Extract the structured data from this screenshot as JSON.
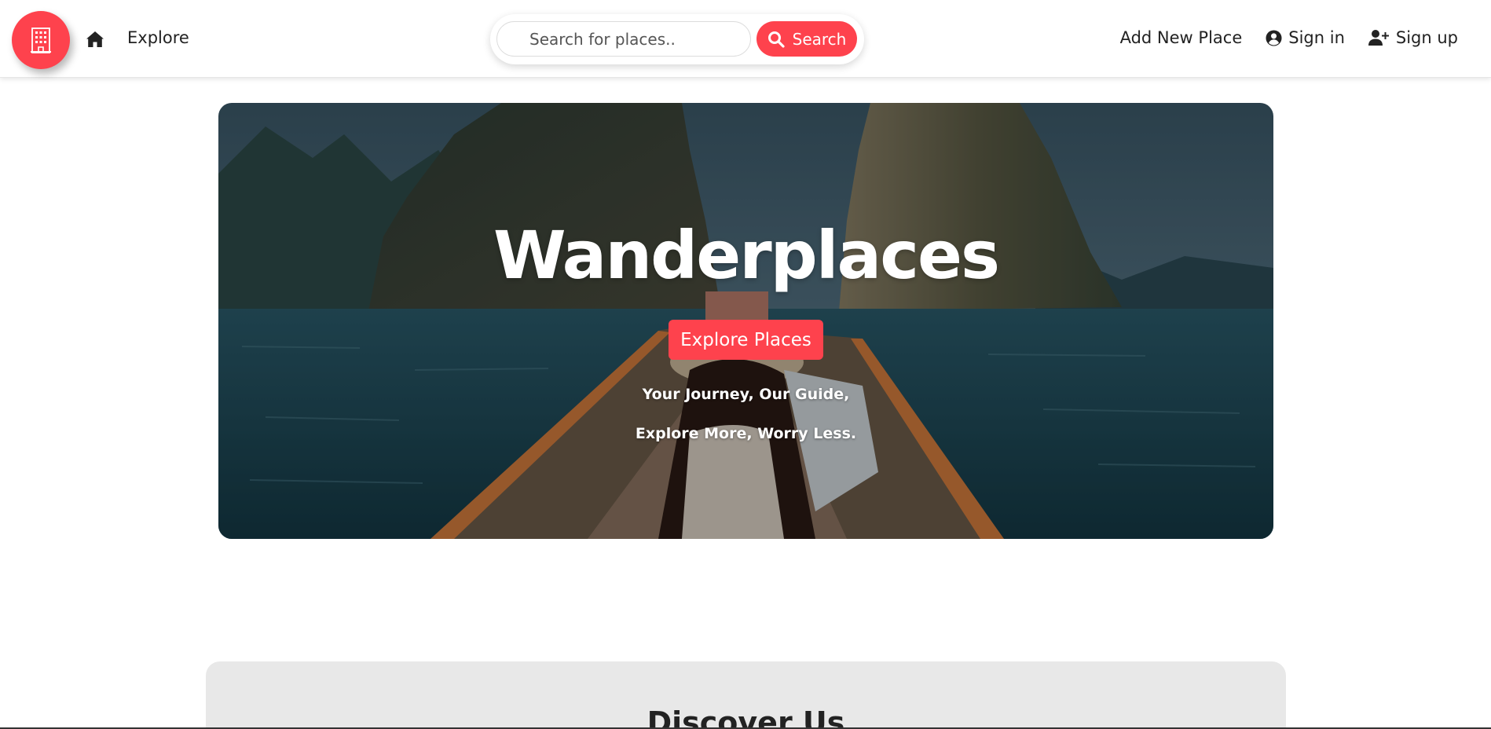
{
  "navbar": {
    "logo_icon": "building-icon",
    "home_icon": "home-icon",
    "explore_label": "Explore",
    "search": {
      "placeholder": "Search for places..",
      "value": "",
      "button_label": "Search",
      "button_icon": "search-icon"
    },
    "add_place_label": "Add New Place",
    "signin_label": "Sign in",
    "signin_icon": "user-circle-icon",
    "signup_label": "Sign up",
    "signup_icon": "user-plus-icon"
  },
  "hero": {
    "title": "Wanderplaces",
    "button_label": "Explore Places",
    "tagline_1": "Your Journey, Our Guide,",
    "tagline_2": "Explore More, Worry Less."
  },
  "discover": {
    "title": "Discover Us"
  },
  "colors": {
    "accent": "#fe424d",
    "text": "#222222",
    "section_bg": "#e8e8e8"
  }
}
